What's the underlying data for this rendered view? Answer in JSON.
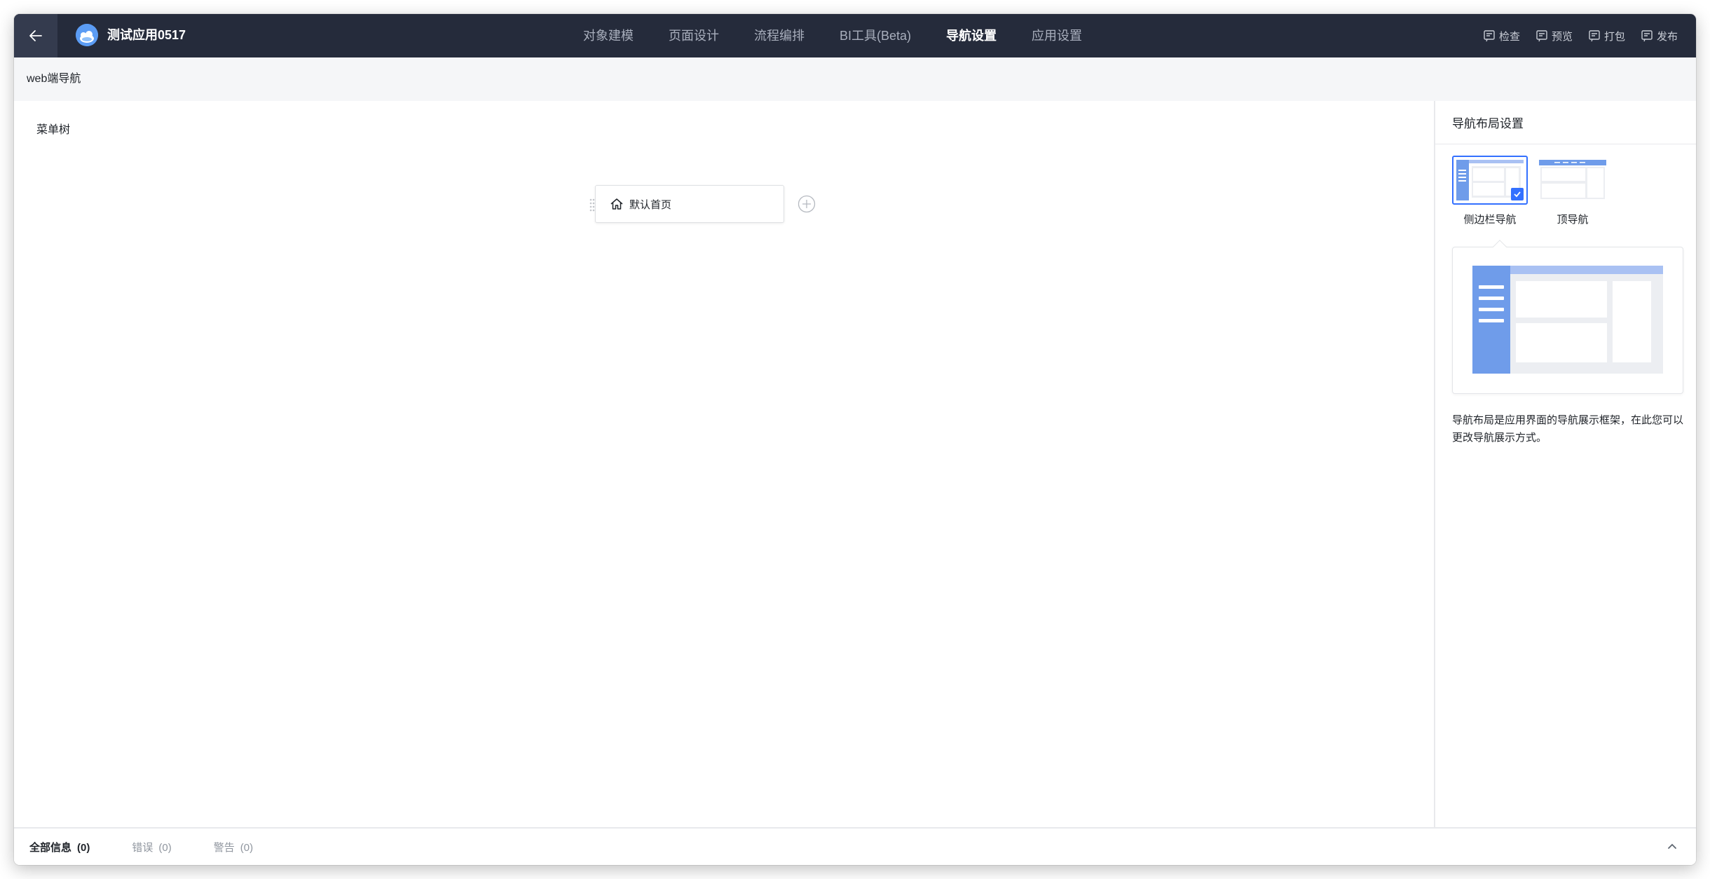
{
  "app": {
    "name": "测试应用0517"
  },
  "main_nav": {
    "tabs": [
      {
        "label": "对象建模",
        "active": false
      },
      {
        "label": "页面设计",
        "active": false
      },
      {
        "label": "流程编排",
        "active": false
      },
      {
        "label": "BI工具(Beta)",
        "active": false
      },
      {
        "label": "导航设置",
        "active": true
      },
      {
        "label": "应用设置",
        "active": false
      }
    ]
  },
  "actions": {
    "check": "检查",
    "preview": "预览",
    "package": "打包",
    "publish": "发布"
  },
  "subheader": {
    "title": "web端导航"
  },
  "canvas": {
    "title": "菜单树",
    "menu_items": [
      {
        "label": "默认首页",
        "icon": "home-icon"
      }
    ]
  },
  "right_panel": {
    "title": "导航布局设置",
    "layout_options": [
      {
        "label": "侧边栏导航",
        "selected": true
      },
      {
        "label": "顶导航",
        "selected": false
      }
    ],
    "description": "导航布局是应用界面的导航展示框架，在此您可以更改导航展示方式。"
  },
  "bottom_bar": {
    "tabs": [
      {
        "label": "全部信息",
        "count": "(0)",
        "active": true
      },
      {
        "label": "错误",
        "count": "(0)",
        "active": false
      },
      {
        "label": "警告",
        "count": "(0)",
        "active": false
      }
    ]
  },
  "colors": {
    "topbar": "#252b3b",
    "accent": "#3370ff",
    "nav_illustration": "#6f9cea"
  }
}
